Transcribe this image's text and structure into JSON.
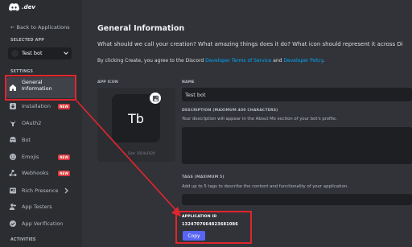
{
  "logo": {
    "text": ".dev"
  },
  "sidebar": {
    "back_label": "← Back to Applications",
    "selected_app_heading": "SELECTED APP",
    "selected_app_name": "Test bot",
    "settings_heading": "SETTINGS",
    "items": [
      {
        "label": "General\nInformation",
        "icon": "home-icon",
        "active": true
      },
      {
        "label": "Installation",
        "icon": "installation-icon",
        "badge": "NEW"
      },
      {
        "label": "OAuth2",
        "icon": "wrench-icon"
      },
      {
        "label": "Bot",
        "icon": "bot-icon"
      },
      {
        "label": "Emojis",
        "icon": "emoji-icon",
        "badge": "NEW"
      },
      {
        "label": "Webhooks",
        "icon": "webhooks-icon",
        "badge": "NEW"
      },
      {
        "label": "Rich Presence",
        "icon": "rich-presence-icon"
      },
      {
        "label": "App Testers",
        "icon": "app-testers-icon"
      },
      {
        "label": "App Verification",
        "icon": "verification-icon"
      }
    ],
    "activities_heading": "ACTIVITIES"
  },
  "main": {
    "title": "General Information",
    "question": "What should we call your creation? What amazing things does it do? What icon should represent it across Di",
    "agree_prefix": "By clicking Create, you agree to the Discord ",
    "tos_link": "Developer Terms of Service",
    "and_text": " and ",
    "policy_link": "Developer Policy",
    "period": ".",
    "app_icon_label": "APP ICON",
    "icon_initials": "Tb",
    "icon_size_hint": "Size: 1024x1024",
    "name_label": "NAME",
    "name_value": "Test bot",
    "description_label": "DESCRIPTION (MAXIMUM 400 CHARACTERS)",
    "description_hint": "Your description will appear in the About Me section of your bot's profile.",
    "tags_label": "TAGS (MAXIMUM 5)",
    "tags_hint": "Add up to 5 tags to describe the content and functionality of your application.",
    "app_id_label": "APPLICATION ID",
    "app_id_value": "1324707664823681086",
    "copy_label": "Copy"
  },
  "colors": {
    "accent": "#5865f2",
    "highlight": "#e0262d",
    "link": "#00a8fc",
    "new_badge": "#da373c"
  }
}
